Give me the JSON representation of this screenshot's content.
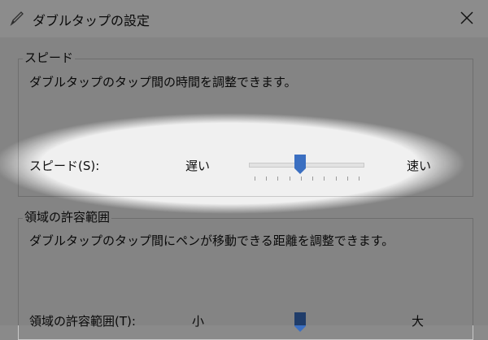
{
  "window": {
    "title": "ダブルタップの設定",
    "title_icon": "pen-icon",
    "close_icon": "close-icon"
  },
  "speed": {
    "group_title": "スピード",
    "description": "ダブルタップのタップ間の時間を調整できます。",
    "slider_label": "スピード(S):",
    "min_label": "遅い",
    "max_label": "速い",
    "value_fraction": 0.45,
    "tick_count": 10
  },
  "area": {
    "group_title": "領域の許容範囲",
    "description": "ダブルタップのタップ間にペンが移動できる距離を調整できます。",
    "slider_label": "領域の許容範囲(T):",
    "min_label": "小",
    "max_label": "大",
    "value_fraction": 0.45
  },
  "colors": {
    "thumb": "#3b6fc1",
    "dim_overlay": "rgba(0,0,0,0.45)"
  }
}
